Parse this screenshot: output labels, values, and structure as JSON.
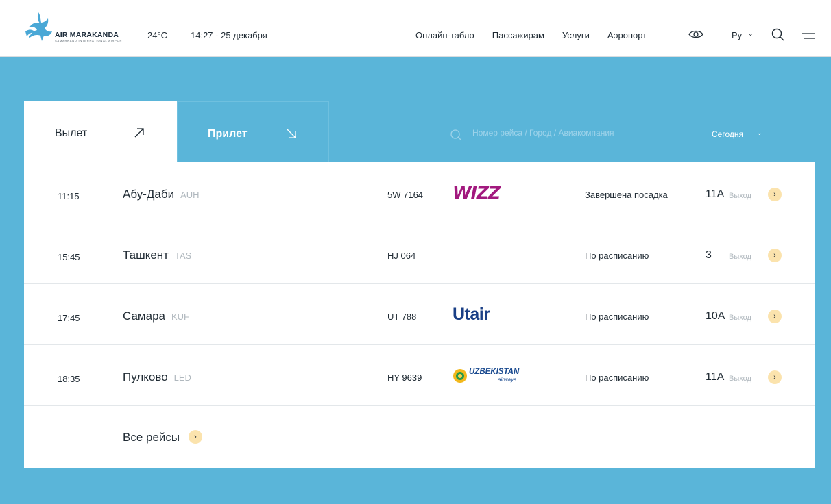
{
  "header": {
    "logo_text": "AIR MARAKANDA",
    "logo_sub": "SAMARKAND INTERNATIONAL AIRPORT",
    "temperature": "24°C",
    "datetime": "14:27 - 25 декабря",
    "nav": [
      "Онлайн-табло",
      "Пассажирам",
      "Услуги",
      "Аэропорт"
    ],
    "language": "Ру"
  },
  "tabs": {
    "departure": "Вылет",
    "arrival": "Прилет"
  },
  "search": {
    "placeholder": "Номер рейса / Город / Авиакомпания"
  },
  "day_selector": "Сегодня",
  "flights": [
    {
      "time": "11:15",
      "city": "Абу-Даби",
      "code": "AUH",
      "flight": "5W 7164",
      "airline": "WIZZ",
      "status": "Завершена посадка",
      "gate": "11A",
      "gate_label": "Выход"
    },
    {
      "time": "15:45",
      "city": "Ташкент",
      "code": "TAS",
      "flight": "HJ 064",
      "airline": "",
      "status": "По расписанию",
      "gate": "3",
      "gate_label": "Выход"
    },
    {
      "time": "17:45",
      "city": "Самара",
      "code": "KUF",
      "flight": "UT 788",
      "airline": "Utair",
      "status": "По расписанию",
      "gate": "10A",
      "gate_label": "Выход"
    },
    {
      "time": "18:35",
      "city": "Пулково",
      "code": "LED",
      "flight": "HY 9639",
      "airline": "UZBEKISTAN airways",
      "status": "По расписанию",
      "gate": "11A",
      "gate_label": "Выход"
    }
  ],
  "all_flights": "Все рейсы",
  "airline_logos": {
    "uzbekistan_name": "UZBEKISTAN",
    "uzbekistan_sub": "airways"
  },
  "colors": {
    "background": "#5ab5d9",
    "accent_button": "#fbe3ad",
    "wizz": "#a2197e",
    "utair": "#1a3f86"
  }
}
